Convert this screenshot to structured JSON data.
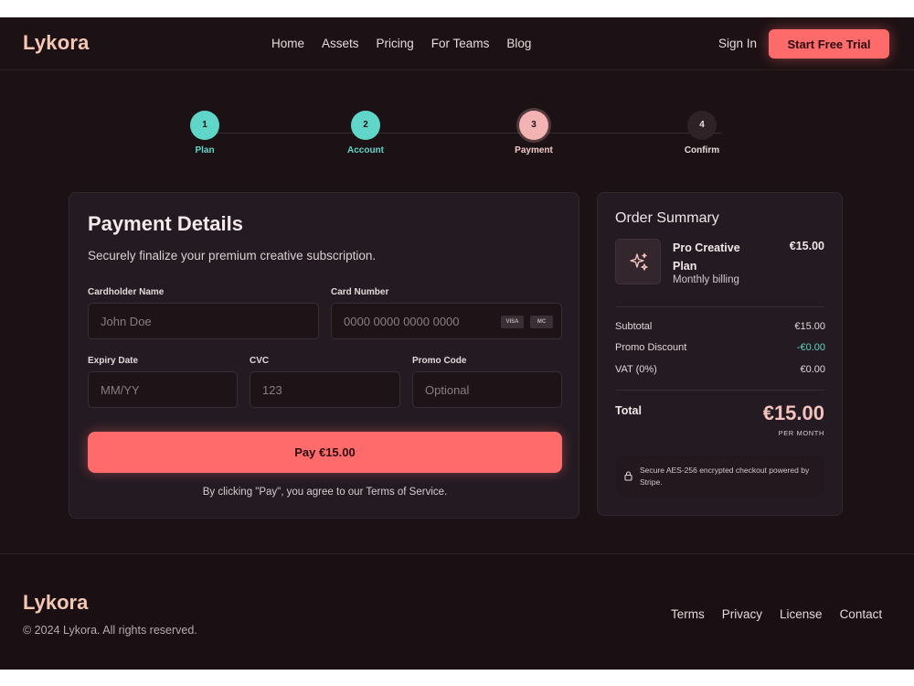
{
  "header": {
    "logo": "Lykora",
    "nav": [
      "Home",
      "Assets",
      "Pricing",
      "For Teams",
      "Blog"
    ],
    "sign_in": "Sign In",
    "cta": "Start Free Trial"
  },
  "stepper": {
    "steps": [
      {
        "number": "1",
        "label": "Plan",
        "state": "done"
      },
      {
        "number": "2",
        "label": "Account",
        "state": "done"
      },
      {
        "number": "3",
        "label": "Payment",
        "state": "active"
      },
      {
        "number": "4",
        "label": "Confirm",
        "state": "todo"
      }
    ]
  },
  "payment": {
    "title": "Payment Details",
    "subtitle": "Securely finalize your premium creative subscription.",
    "cardholder": {
      "label": "Cardholder Name",
      "placeholder": "John Doe",
      "value": ""
    },
    "card_number": {
      "label": "Card Number",
      "placeholder": "0000 0000 0000 0000",
      "value": "",
      "badges": [
        "VISA",
        "MC"
      ]
    },
    "expiry": {
      "label": "Expiry Date",
      "placeholder": "MM/YY",
      "value": ""
    },
    "cvc": {
      "label": "CVC",
      "placeholder": "123",
      "value": ""
    },
    "promo": {
      "label": "Promo Code",
      "placeholder": "Optional",
      "value": ""
    },
    "pay_button": "Pay €15.00",
    "terms_note": "By clicking \"Pay\", you agree to our Terms of Service."
  },
  "summary": {
    "title": "Order Summary",
    "plan_name": "Pro Creative Plan",
    "plan_billing": "Monthly billing",
    "plan_price": "€15.00",
    "plan_icon": "sparkles-icon",
    "rows": [
      {
        "label": "Subtotal",
        "value": "€15.00"
      },
      {
        "label": "Promo Discount",
        "value": "-€0.00"
      },
      {
        "label": "VAT (0%)",
        "value": "€0.00"
      }
    ],
    "total_label": "Total",
    "total_amount": "€15.00",
    "total_period": "PER MONTH",
    "secure_note": "Secure AES-256 encrypted checkout powered by Stripe."
  },
  "footer": {
    "logo": "Lykora",
    "copyright": "© 2024 Lykora. All rights reserved.",
    "links": [
      "Terms",
      "Privacy",
      "License",
      "Contact"
    ]
  },
  "colors": {
    "accent": "#ff6b6b",
    "teal": "#5fd6c8",
    "background": "#1c1114",
    "panel": "#231a22"
  }
}
